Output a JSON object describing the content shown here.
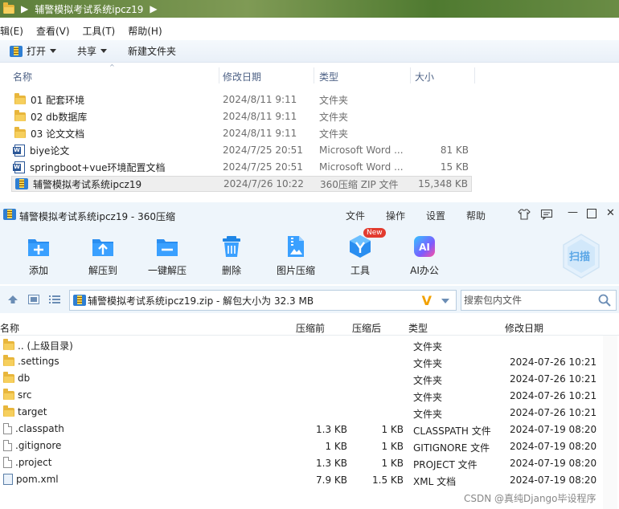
{
  "explorer": {
    "breadcrumb": "辅警模拟考试系统ipcz19",
    "menu": [
      "辑(E)",
      "查看(V)",
      "工具(T)",
      "帮助(H)"
    ],
    "toolbar": {
      "open": "打开",
      "share": "共享",
      "new_folder": "新建文件夹"
    },
    "columns": {
      "name": "名称",
      "date": "修改日期",
      "type": "类型",
      "size": "大小"
    },
    "files": [
      {
        "name": "01 配套环境",
        "date": "2024/8/11 9:11",
        "type": "文件夹",
        "size": "",
        "icon": "folder-icon"
      },
      {
        "name": "02 db数据库",
        "date": "2024/8/11 9:11",
        "type": "文件夹",
        "size": "",
        "icon": "folder-icon"
      },
      {
        "name": "03 论文文档",
        "date": "2024/8/11 9:11",
        "type": "文件夹",
        "size": "",
        "icon": "folder-icon"
      },
      {
        "name": "biye论文",
        "date": "2024/7/25 20:51",
        "type": "Microsoft Word ...",
        "size": "81 KB",
        "icon": "word-icon"
      },
      {
        "name": "springboot+vue环境配置文档",
        "date": "2024/7/25 20:51",
        "type": "Microsoft Word ...",
        "size": "15 KB",
        "icon": "word-icon"
      },
      {
        "name": "辅警模拟考试系统ipcz19",
        "date": "2024/7/26 10:22",
        "type": "360压缩 ZIP 文件",
        "size": "15,348 KB",
        "icon": "zip-icon"
      }
    ]
  },
  "zip": {
    "title": "辅警模拟考试系统ipcz19 - 360压缩",
    "menus": [
      "文件",
      "操作",
      "设置",
      "帮助"
    ],
    "tools": [
      {
        "label": "添加",
        "icon": "add-icon"
      },
      {
        "label": "解压到",
        "icon": "extract-to-icon"
      },
      {
        "label": "一键解压",
        "icon": "one-click-extract-icon"
      },
      {
        "label": "删除",
        "icon": "delete-icon"
      },
      {
        "label": "图片压缩",
        "icon": "image-compress-icon"
      },
      {
        "label": "工具",
        "icon": "tools-icon"
      },
      {
        "label": "AI办公",
        "icon": "ai-office-icon"
      }
    ],
    "new_badge": "New",
    "ai_text": "AI",
    "scan_label": "扫描",
    "path_text": "辅警模拟考试系统ipcz19.zip - 解包大小为 32.3 MB",
    "path_logo": "V",
    "search_placeholder": "搜索包内文件",
    "columns": {
      "name": "名称",
      "compressed": "压缩前",
      "after": "压缩后",
      "type": "类型",
      "date": "修改日期"
    },
    "entries": [
      {
        "name": ".. (上级目录)",
        "before": "",
        "after": "",
        "type": "文件夹",
        "date": "",
        "icon": "folder-icon"
      },
      {
        "name": ".settings",
        "before": "",
        "after": "",
        "type": "文件夹",
        "date": "2024-07-26 10:21",
        "icon": "folder-icon"
      },
      {
        "name": "db",
        "before": "",
        "after": "",
        "type": "文件夹",
        "date": "2024-07-26 10:21",
        "icon": "folder-icon"
      },
      {
        "name": "src",
        "before": "",
        "after": "",
        "type": "文件夹",
        "date": "2024-07-26 10:21",
        "icon": "folder-icon"
      },
      {
        "name": "target",
        "before": "",
        "after": "",
        "type": "文件夹",
        "date": "2024-07-26 10:21",
        "icon": "folder-icon"
      },
      {
        "name": ".classpath",
        "before": "1.3 KB",
        "after": "1 KB",
        "type": "CLASSPATH 文件",
        "date": "2024-07-19 08:20",
        "icon": "file-icon"
      },
      {
        "name": ".gitignore",
        "before": "1 KB",
        "after": "1 KB",
        "type": "GITIGNORE 文件",
        "date": "2024-07-19 08:20",
        "icon": "file-icon"
      },
      {
        "name": ".project",
        "before": "1.3 KB",
        "after": "1 KB",
        "type": "PROJECT 文件",
        "date": "2024-07-19 08:20",
        "icon": "file-icon"
      },
      {
        "name": "pom.xml",
        "before": "7.9 KB",
        "after": "1.5 KB",
        "type": "XML 文档",
        "date": "2024-07-19 08:20",
        "icon": "xml-file-icon"
      }
    ]
  },
  "watermark": "CSDN @真纯Django毕设程序"
}
